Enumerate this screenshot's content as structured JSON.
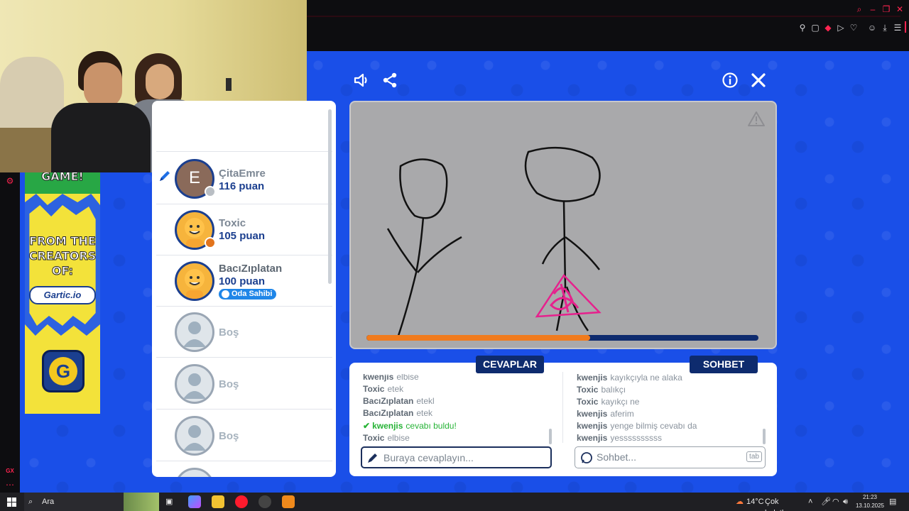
{
  "browser": {
    "extension_badge": "GX"
  },
  "ad": {
    "top_word": "GAME!",
    "headline_lines": [
      "FROM THE",
      "CREATORS",
      "OF:"
    ],
    "brand": "Gartic.io"
  },
  "players": [
    {
      "name": "ÇitaEmre",
      "score": "116 puan",
      "avatar_letter": "E"
    },
    {
      "name": "Toxic",
      "score": "105 puan"
    },
    {
      "name": "BacıZıplatan",
      "score": "100 puan",
      "badge": "Oda Sahibi"
    }
  ],
  "empty_slot_label": "Boş",
  "timer": {
    "progress": 0.57
  },
  "tabs": {
    "answers": "CEVAPLAR",
    "chat": "SOHBET"
  },
  "answers": [
    {
      "user": "kwenjis",
      "text": "elbise"
    },
    {
      "user": "Toxic",
      "text": "etek"
    },
    {
      "user": "BacıZıplatan",
      "text": "etekl"
    },
    {
      "user": "BacıZıplatan",
      "text": "etek"
    },
    {
      "user": "kwenjis",
      "text": "cevabı buldu!",
      "success": true
    },
    {
      "user": "Toxic",
      "text": "elbise"
    }
  ],
  "chat": [
    {
      "user": "kwenjis",
      "text": "kayıkçıyla ne alaka"
    },
    {
      "user": "Toxic",
      "text": "balıkçı"
    },
    {
      "user": "Toxic",
      "text": "kayıkçı ne"
    },
    {
      "user": "kwenjis",
      "text": "aferim"
    },
    {
      "user": "kwenjis",
      "text": "yenge bilmiş cevabı da"
    },
    {
      "user": "kwenjis",
      "text": "yessssssssss"
    }
  ],
  "inputs": {
    "answer_placeholder": "Buraya cevaplayın...",
    "chat_placeholder": "Sohbet...",
    "tab_hint": "tab"
  },
  "taskbar": {
    "search_label": "Ara",
    "temperature": "14°C",
    "weather": "Çok bulutlu",
    "time": "21:23",
    "date": "13.10.2025"
  },
  "colors": {
    "game_blue": "#1a4fe8",
    "navy": "#0e2b6e",
    "timer_orange": "#f07b1e",
    "success_green": "#26b336"
  }
}
